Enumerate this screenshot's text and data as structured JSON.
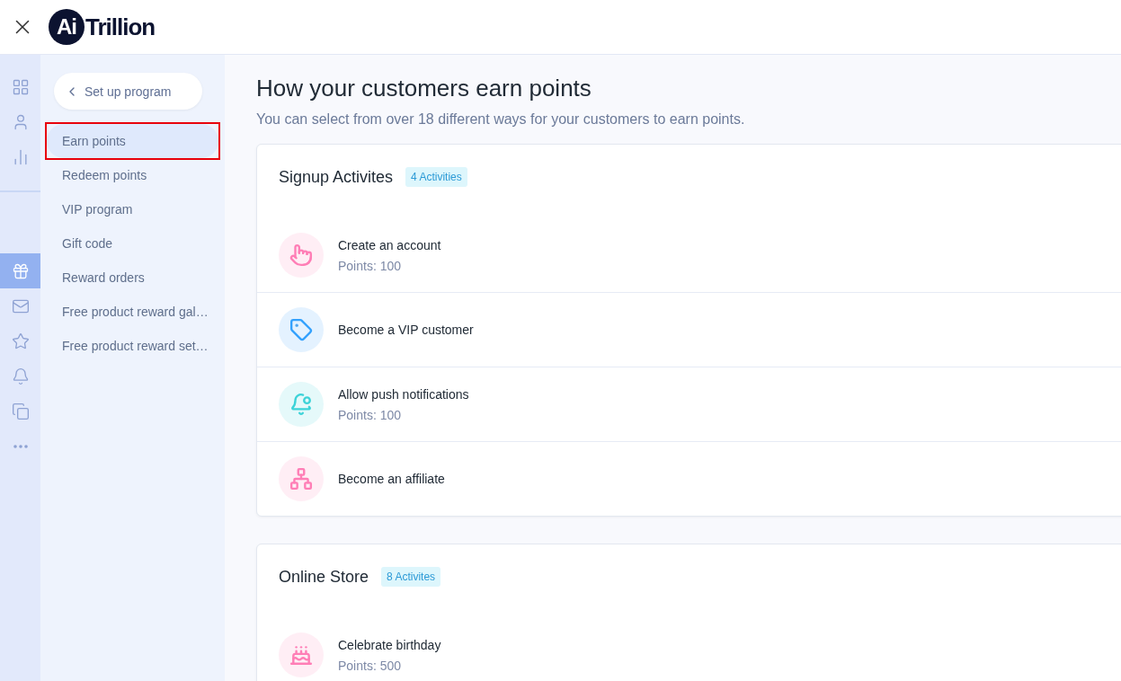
{
  "header": {
    "logo_mark": "Ai",
    "logo_text": "Trillion"
  },
  "rail": [
    {
      "selected": false
    },
    {
      "selected": false
    },
    {
      "selected": false
    },
    {
      "selected": true
    },
    {
      "selected": false
    },
    {
      "selected": false
    },
    {
      "selected": false
    },
    {
      "selected": false
    },
    {
      "selected": false
    }
  ],
  "sidebar": {
    "back_button": "Set up program",
    "items": [
      {
        "label": "Earn points",
        "selected": true,
        "annotated": true
      },
      {
        "label": "Redeem points",
        "selected": false,
        "annotated": false
      },
      {
        "label": "VIP program",
        "selected": false,
        "annotated": false
      },
      {
        "label": "Gift code",
        "selected": false,
        "annotated": false
      },
      {
        "label": "Reward orders",
        "selected": false,
        "annotated": false
      },
      {
        "label": "Free product reward gal…",
        "selected": false,
        "annotated": false
      },
      {
        "label": "Free product reward set…",
        "selected": false,
        "annotated": false
      }
    ]
  },
  "main": {
    "title": "How your customers earn points",
    "subtitle": "You can select from over 18 different ways for your customers to earn points.",
    "sections": [
      {
        "title": "Signup Activites",
        "badge": "4 Activities",
        "activities": [
          {
            "color": "#ff7eb6",
            "name": "Create an account",
            "points": "Points: 100"
          },
          {
            "color": "#33a1fd",
            "name": "Become a VIP customer"
          },
          {
            "color": "#3dd3d8",
            "name": "Allow push notifications",
            "points": "Points: 100"
          },
          {
            "color": "#ff7eb6",
            "name": "Become an affiliate"
          }
        ]
      },
      {
        "title": "Online Store",
        "badge": "8 Activites",
        "activities": [
          {
            "color": "#ff7eb6",
            "name": "Celebrate birthday",
            "points": "Points: 500"
          }
        ]
      }
    ]
  }
}
